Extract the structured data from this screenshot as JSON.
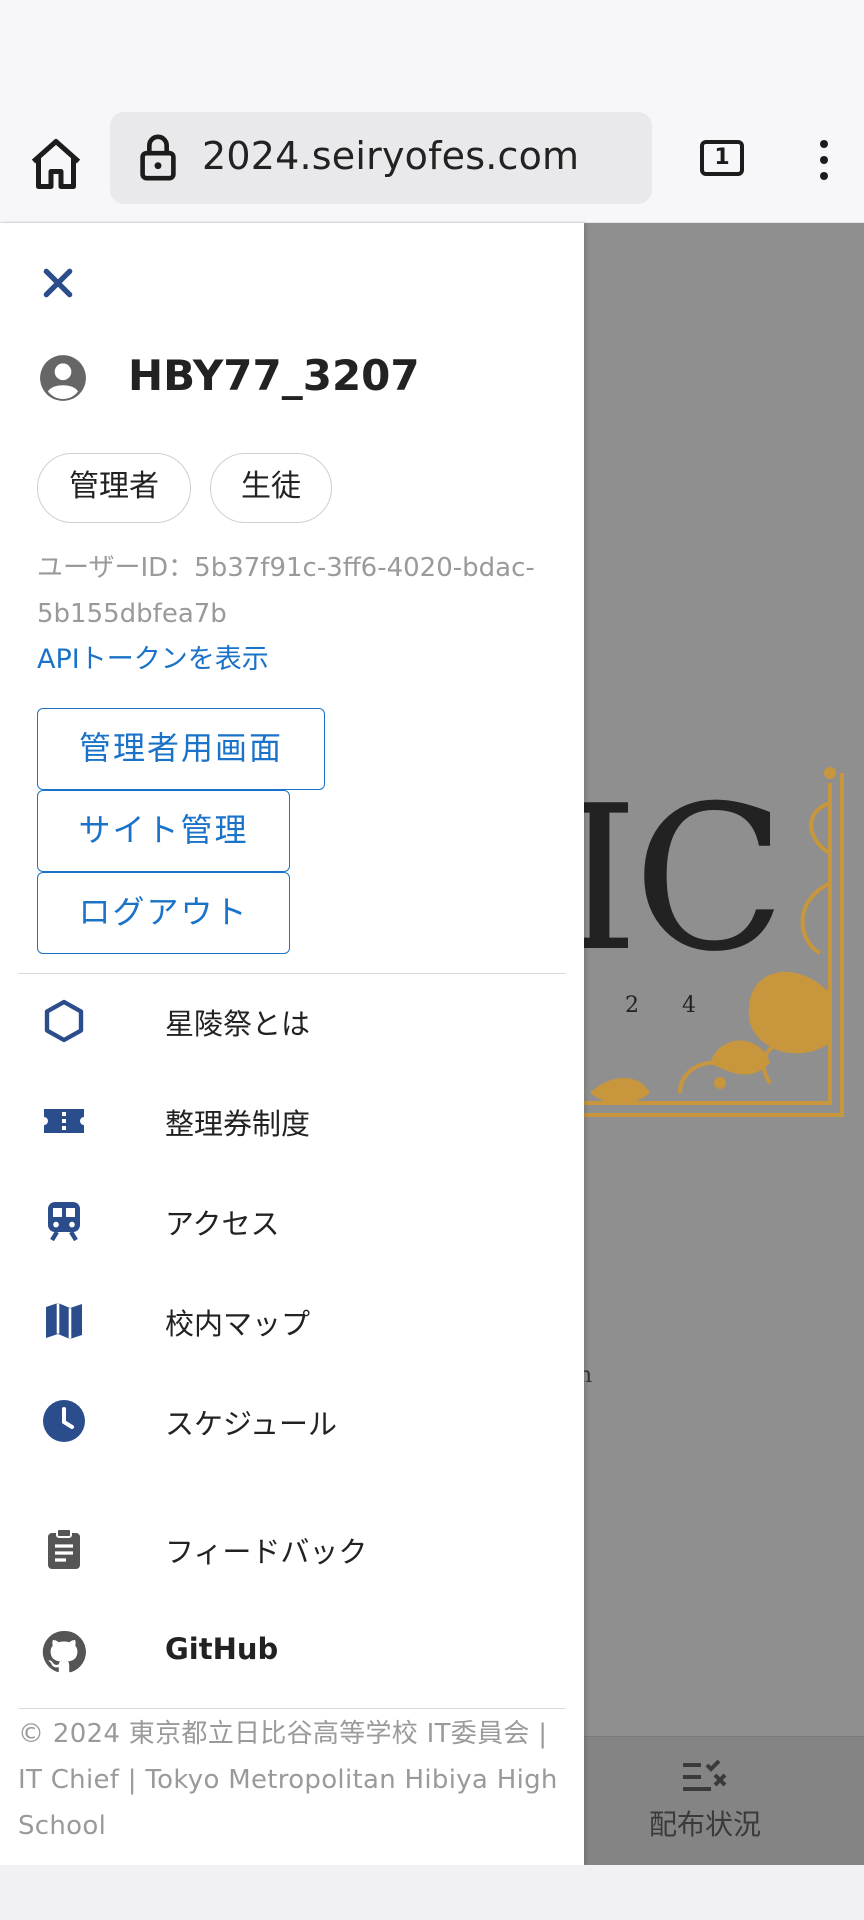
{
  "browser": {
    "url": "2024.seiryofes.com",
    "tab_count": "1"
  },
  "background": {
    "hero_text": "IC",
    "year_text": "2 2 4",
    "stray_text": "n",
    "bottom_nav_label": "配布状況"
  },
  "drawer": {
    "username": "HBY77_3207",
    "roles": [
      "管理者",
      "生徒"
    ],
    "user_id_text": "ユーザーID：5b37f91c-3ff6-4020-bdac-5b155dbfea7b",
    "api_link": "APIトークンを表示",
    "buttons": {
      "admin": "管理者用画面",
      "site": "サイト管理",
      "logout": "ログアウト"
    },
    "nav": [
      {
        "label": "星陵祭とは",
        "icon": "hexagon-icon"
      },
      {
        "label": "整理券制度",
        "icon": "ticket-icon"
      },
      {
        "label": "アクセス",
        "icon": "train-icon"
      },
      {
        "label": "校内マップ",
        "icon": "map-icon"
      },
      {
        "label": "スケジュール",
        "icon": "clock-icon"
      },
      {
        "label": "フィードバック",
        "icon": "clipboard-icon"
      },
      {
        "label": "GitHub",
        "icon": "github-icon"
      }
    ],
    "footer": "© 2024 東京都立日比谷高等学校 IT委員会 | IT Chief | Tokyo Metropolitan Hibiya High School"
  },
  "colors": {
    "accent_blue": "#1a73c8",
    "icon_navy": "#2c4d8c",
    "ornament_gold": "#c8963c"
  }
}
